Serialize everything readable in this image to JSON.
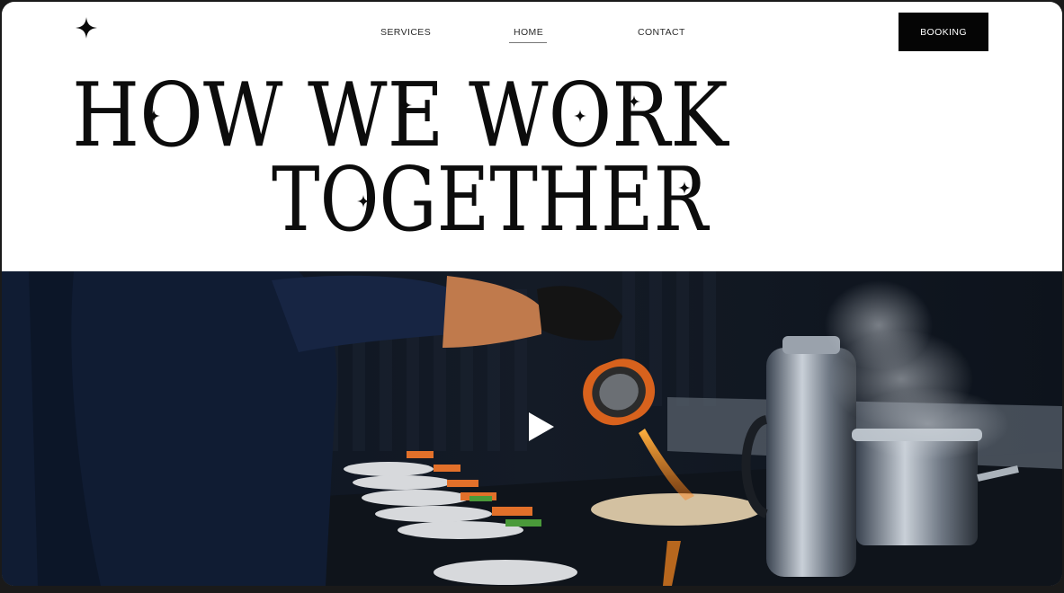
{
  "header": {
    "logo_icon": "four-point-star-icon",
    "nav": {
      "services": "SERVICES",
      "home": "HOME",
      "contact": "CONTACT"
    },
    "booking_label": "BOOKING"
  },
  "hero": {
    "headline_line1": "HOW WE WORK",
    "headline_line2": "TOGETHER",
    "video": {
      "play_icon": "play-icon",
      "description_colors": {
        "background": "#0e1420",
        "accent_orange": "#e07020"
      }
    }
  },
  "colors": {
    "page_bg": "#ffffff",
    "text": "#0c0c0c",
    "button_bg": "#050505",
    "button_text": "#ffffff"
  }
}
